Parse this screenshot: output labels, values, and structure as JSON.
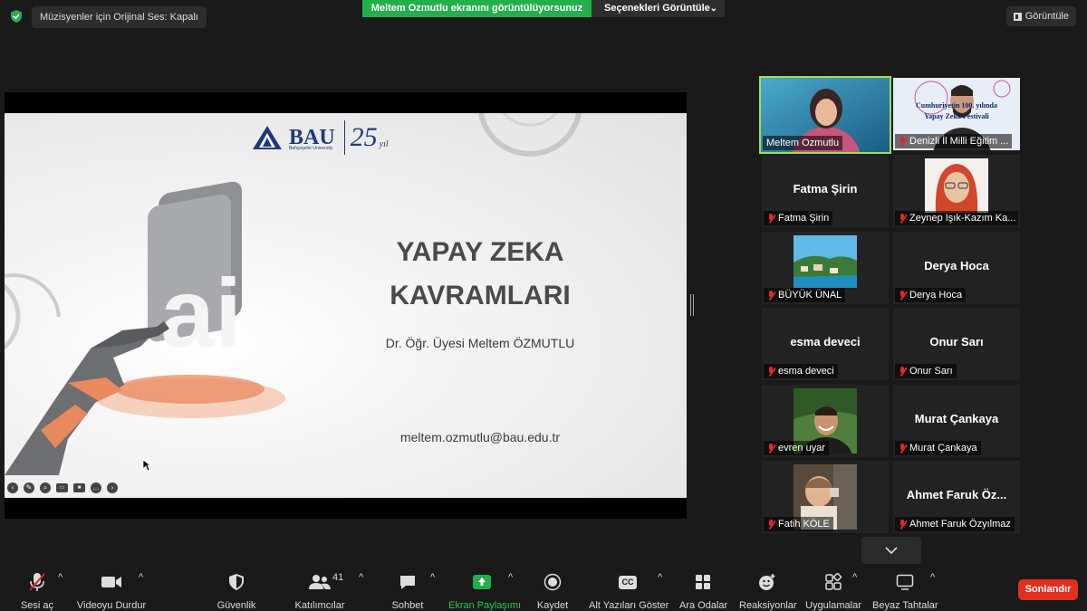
{
  "topbar": {
    "original_audio": "Müzisyenler için Orijinal Ses: Kapalı",
    "share_banner": "Meltem Ozmutlu ekranını görüntülüyorsunuz",
    "view_options": "Seçenekleri Görüntüle",
    "view_button": "Görüntüle"
  },
  "slide": {
    "logo_text": "BAU",
    "logo_sub": "Bahçeşehir University",
    "logo_anniv": "25",
    "logo_anniv_suffix": "yıl",
    "ai_letters": "ai",
    "title_line1": "YAPAY ZEKA",
    "title_line2": "KAVRAMLARI",
    "author": "Dr. Öğr. Üyesi Meltem ÖZMUTLU",
    "email": "meltem.ozmutlu@bau.edu.tr"
  },
  "gallery": {
    "tiles": [
      {
        "label": "Meltem Ozmutlu",
        "big": "",
        "muted": false,
        "active": true
      },
      {
        "label": "Denizli İl Milli Eğitim ...",
        "big": "",
        "muted": true,
        "bg_text1": "Cumhuriyetin 100. yılında",
        "bg_text2": "Yapay Zeka Festivali"
      },
      {
        "label": "Fatma Şirin",
        "big": "Fatma Şirin",
        "muted": true
      },
      {
        "label": "Zeynep Işık-Kazım Ka...",
        "big": "",
        "muted": true
      },
      {
        "label": "BÜYÜK ÜNAL",
        "big": "",
        "muted": true
      },
      {
        "label": "Derya Hoca",
        "big": "Derya Hoca",
        "muted": true
      },
      {
        "label": "esma deveci",
        "big": "esma deveci",
        "muted": true
      },
      {
        "label": "Onur Sarı",
        "big": "Onur Sarı",
        "muted": true
      },
      {
        "label": "evren uyar",
        "big": "",
        "muted": true
      },
      {
        "label": "Murat Çankaya",
        "big": "Murat Çankaya",
        "muted": true
      },
      {
        "label": "Fatih KÖLE",
        "big": "",
        "muted": true
      },
      {
        "label": "Ahmet Faruk Özyılmaz",
        "big": "Ahmet Faruk Öz...",
        "muted": true
      }
    ]
  },
  "toolbar": {
    "mute": "Sesi aç",
    "video": "Videoyu Durdur",
    "security": "Güvenlik",
    "participants": "Katılımcılar",
    "participants_count": "41",
    "chat": "Sohbet",
    "share": "Ekran Paylaşımı",
    "record": "Kaydet",
    "captions": "Alt Yazıları Göster",
    "cc": "CC",
    "breakout": "Ara Odalar",
    "reactions": "Reaksiyonlar",
    "apps": "Uygulamalar",
    "whiteboard": "Beyaz Tahtalar",
    "end": "Sonlandır"
  },
  "colors": {
    "share_green": "#23b04b",
    "end_red": "#e0301e",
    "active_speaker": "#9ee04d",
    "muted_red": "#e02828"
  }
}
